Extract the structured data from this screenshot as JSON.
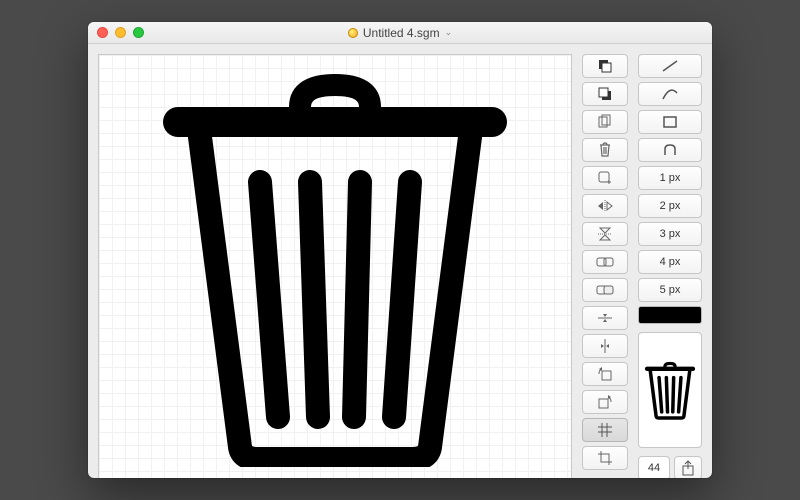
{
  "window": {
    "title": "Untitled 4.sgm",
    "chevron": "⌄"
  },
  "stroke_widths": {
    "w1": "1 px",
    "w2": "2 px",
    "w3": "3 px",
    "w4": "4 px",
    "w5": "5 px"
  },
  "preview_size": "44"
}
